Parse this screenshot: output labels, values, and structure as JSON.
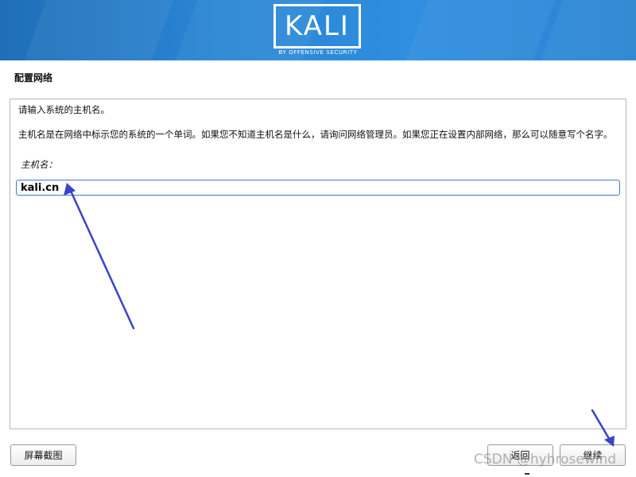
{
  "banner": {
    "logo_text": "KALI",
    "logo_subtitle": "BY OFFENSIVE SECURITY",
    "gradient_colors": [
      "#1f6fb8",
      "#2f8ee0"
    ]
  },
  "page": {
    "title": "配置网络"
  },
  "form": {
    "prompt": "请输入系统的主机名。",
    "description": "主机名是在网络中标示您的系统的一个单词。如果您不知道主机名是什么，请询问网络管理员。如果您正在设置内部网络，那么可以随意写个名字。",
    "hostname_label": "主机名：",
    "hostname_value": "kali.cn",
    "input_border_color": "#3a7bd5"
  },
  "buttons": {
    "screenshot_label": "屏幕截图",
    "back_label": "返回",
    "continue_label": "继续"
  },
  "annotations": {
    "arrow_color": "#3b43c8"
  },
  "watermark": {
    "text": "CSDN @hyhrosewind"
  }
}
